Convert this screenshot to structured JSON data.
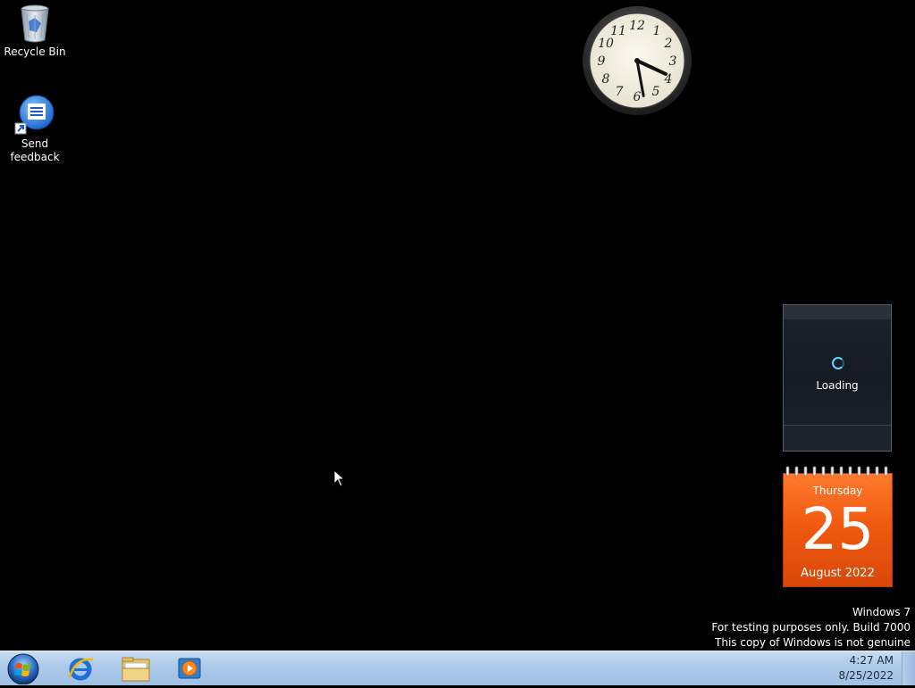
{
  "desktop": {
    "icons": [
      {
        "label": "Recycle Bin"
      },
      {
        "label": "Send feedback"
      }
    ]
  },
  "gadgets": {
    "clock": {
      "time": "4:27"
    },
    "loading": {
      "text": "Loading"
    },
    "calendar": {
      "day": "Thursday",
      "date": "25",
      "month": "August 2022"
    }
  },
  "watermark": {
    "line1": "Windows 7",
    "line2": "For testing purposes only. Build 7000",
    "line3": "This copy of Windows is not genuine"
  },
  "taskbar": {
    "pinned": [
      {
        "icon": "internet-explorer-icon"
      },
      {
        "icon": "windows-explorer-icon"
      },
      {
        "icon": "media-player-icon"
      }
    ],
    "tray": {
      "time": "4:27 AM",
      "date": "8/25/2022"
    }
  },
  "colors": {
    "desktop_bg": "#000000",
    "calendar_orange": "#f05a10",
    "taskbar": "#aecbea"
  }
}
